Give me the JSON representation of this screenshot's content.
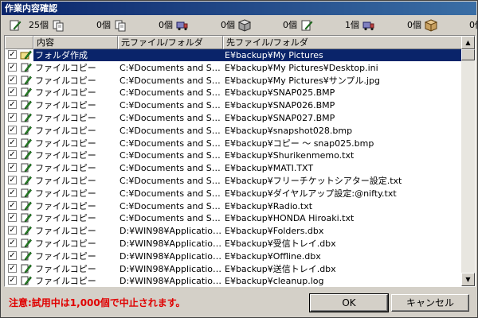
{
  "window": {
    "title": "作業内容確認"
  },
  "counters": [
    {
      "value": "25個",
      "icon": "folder-pencil-icon"
    },
    {
      "value": "0個",
      "icon": "copy-file-icon"
    },
    {
      "value": "0個",
      "icon": "truck-icon"
    },
    {
      "value": "0個",
      "icon": "box-icon"
    },
    {
      "value": "0個",
      "icon": "pencil-icon"
    },
    {
      "value": "1個",
      "icon": "truck-icon"
    },
    {
      "value": "0個",
      "icon": "package-icon"
    },
    {
      "value": "0個",
      "icon": ""
    }
  ],
  "columns": {
    "type": "内容",
    "source": "元ファイル/フォルダ",
    "dest": "先ファイル/フォルダ"
  },
  "rows": [
    {
      "type": "フォルダ作成",
      "src": "",
      "dst": "E¥backup¥My Pictures",
      "selected": true,
      "icon": "folder-pencil"
    },
    {
      "type": "ファイルコピー",
      "src": "C:¥Documents and Sett...",
      "dst": "E¥backup¥My Pictures¥Desktop.ini"
    },
    {
      "type": "ファイルコピー",
      "src": "C:¥Documents and Sett...",
      "dst": "E¥backup¥My Pictures¥サンプル.jpg"
    },
    {
      "type": "ファイルコピー",
      "src": "C:¥Documents and Sett...",
      "dst": "E¥backup¥SNAP025.BMP"
    },
    {
      "type": "ファイルコピー",
      "src": "C:¥Documents and Sett...",
      "dst": "E¥backup¥SNAP026.BMP"
    },
    {
      "type": "ファイルコピー",
      "src": "C:¥Documents and Sett...",
      "dst": "E¥backup¥SNAP027.BMP"
    },
    {
      "type": "ファイルコピー",
      "src": "C:¥Documents and Sett...",
      "dst": "E¥backup¥snapshot028.bmp"
    },
    {
      "type": "ファイルコピー",
      "src": "C:¥Documents and Sett...",
      "dst": "E¥backup¥コピー ～ snap025.bmp"
    },
    {
      "type": "ファイルコピー",
      "src": "C:¥Documents and Sett...",
      "dst": "E¥backup¥Shurikenmemo.txt"
    },
    {
      "type": "ファイルコピー",
      "src": "C:¥Documents and Sett...",
      "dst": "E¥backup¥MATI.TXT"
    },
    {
      "type": "ファイルコピー",
      "src": "C:¥Documents and Sett...",
      "dst": "E¥backup¥フリーチケットシアター設定.txt"
    },
    {
      "type": "ファイルコピー",
      "src": "C:¥Documents and Sett...",
      "dst": "E¥backup¥ダイヤルアップ設定:@nifty.txt"
    },
    {
      "type": "ファイルコピー",
      "src": "C:¥Documents and Sett...",
      "dst": "E¥backup¥Radio.txt"
    },
    {
      "type": "ファイルコピー",
      "src": "C:¥Documents and Sett...",
      "dst": "E¥backup¥HONDA Hiroaki.txt"
    },
    {
      "type": "ファイルコピー",
      "src": "D:¥WIN98¥Application ...",
      "dst": "E¥backup¥Folders.dbx"
    },
    {
      "type": "ファイルコピー",
      "src": "D:¥WIN98¥Application ...",
      "dst": "E¥backup¥受信トレイ.dbx"
    },
    {
      "type": "ファイルコピー",
      "src": "D:¥WIN98¥Application ...",
      "dst": "E¥backup¥Offline.dbx"
    },
    {
      "type": "ファイルコピー",
      "src": "D:¥WIN98¥Application ...",
      "dst": "E¥backup¥送信トレイ.dbx"
    },
    {
      "type": "ファイルコピー",
      "src": "D:¥WIN98¥Application ...",
      "dst": "E¥backup¥cleanup.log"
    }
  ],
  "notice": "注意:試用中は1,000個で中止されます。",
  "buttons": {
    "ok": "OK",
    "cancel": "キャンセル"
  }
}
